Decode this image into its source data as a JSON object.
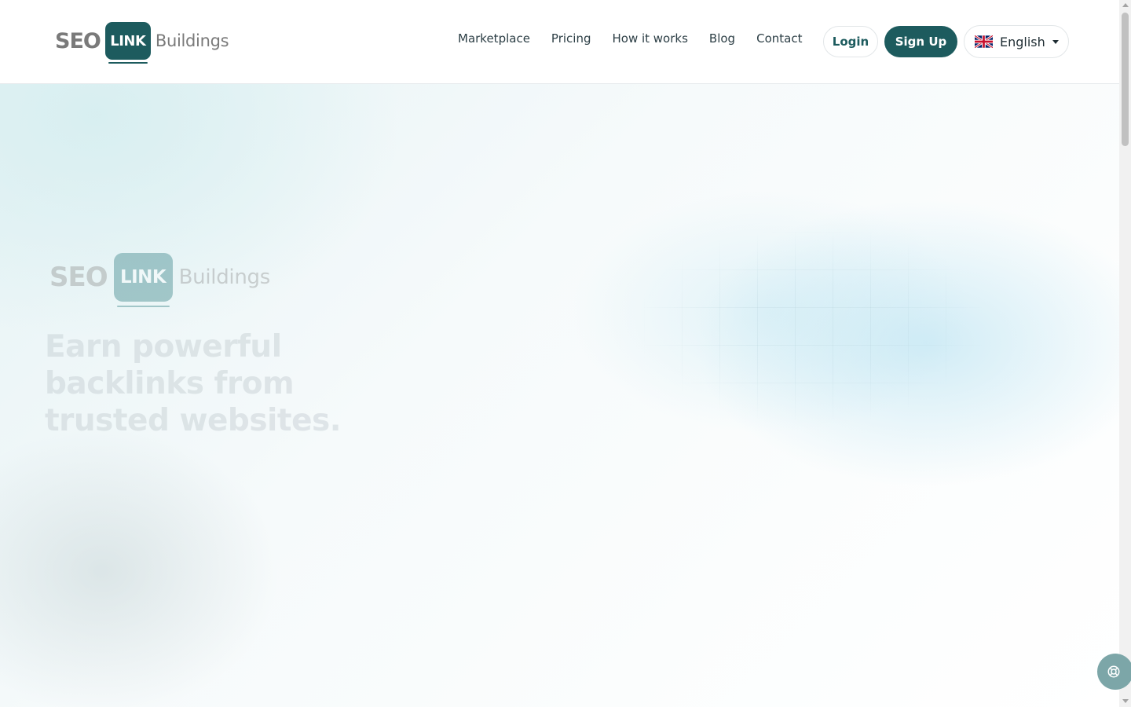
{
  "header": {
    "logo": {
      "seo": "SEO",
      "link": "LINK",
      "buildings": "Buildings"
    },
    "nav": [
      {
        "label": "Marketplace"
      },
      {
        "label": "Pricing"
      },
      {
        "label": "How it works"
      },
      {
        "label": "Blog"
      },
      {
        "label": "Contact"
      }
    ],
    "login_label": "Login",
    "signup_label": "Sign Up",
    "language": {
      "label": "English",
      "flag_icon": "uk-flag-icon"
    }
  },
  "hero": {
    "logo": {
      "seo": "SEO",
      "link": "LINK",
      "buildings": "Buildings"
    },
    "title_lines": [
      "Earn powerful",
      "backlinks from",
      "trusted websites."
    ]
  },
  "widgets": {
    "help_icon": "lifebuoy-icon"
  },
  "colors": {
    "brand": "#1d5b5e",
    "text": "#2c3e45",
    "logo_gray": "#7a7a7a"
  }
}
